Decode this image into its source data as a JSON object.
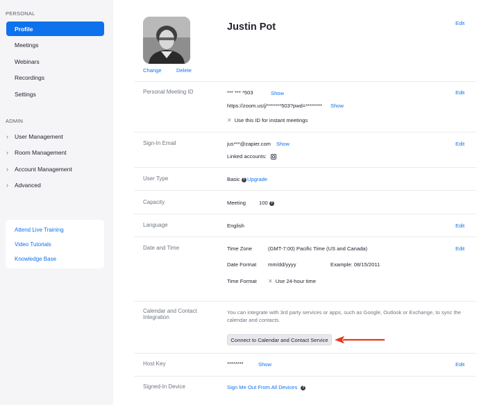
{
  "sidebar": {
    "personal_title": "PERSONAL",
    "personal_items": [
      {
        "label": "Profile",
        "active": true
      },
      {
        "label": "Meetings"
      },
      {
        "label": "Webinars"
      },
      {
        "label": "Recordings"
      },
      {
        "label": "Settings"
      }
    ],
    "admin_title": "ADMIN",
    "admin_items": [
      {
        "label": "User Management"
      },
      {
        "label": "Room Management"
      },
      {
        "label": "Account Management"
      },
      {
        "label": "Advanced"
      }
    ],
    "links": [
      "Attend Live Training",
      "Video Tutorials",
      "Knowledge Base"
    ]
  },
  "profile": {
    "name": "Justin Pot",
    "change": "Change",
    "delete": "Delete",
    "edit": "Edit"
  },
  "pmi": {
    "label": "Personal Meeting ID",
    "id_masked": "*** *** *503",
    "show": "Show",
    "url": "https://zoom.us/j/*******503?pwd=********",
    "url_show": "Show",
    "instant": "Use this ID for instant meetings",
    "edit": "Edit"
  },
  "email": {
    "label": "Sign-In Email",
    "value": "jus***@zapier.com",
    "show": "Show",
    "linked": "Linked accounts:",
    "edit": "Edit"
  },
  "user_type": {
    "label": "User Type",
    "value": "Basic",
    "upgrade": "Upgrade"
  },
  "capacity": {
    "label": "Capacity",
    "meeting": "Meeting",
    "count": "100"
  },
  "language": {
    "label": "Language",
    "value": "English",
    "edit": "Edit"
  },
  "datetime": {
    "label": "Date and Time",
    "tz_label": "Time Zone",
    "tz_value": "(GMT-7:00) Pacific Time (US and Canada)",
    "df_label": "Date Format",
    "df_value": "mm/dd/yyyy",
    "df_example": "Example:  08/15/2011",
    "tf_label": "Time Format",
    "tf_value": "Use 24-hour time",
    "edit": "Edit"
  },
  "calendar": {
    "label_line1": "Calendar and Contact",
    "label_line2": "Integration",
    "desc_line1": "You can integrate with 3rd party services or apps, such as Google, Outlook or Exchange, to sync the",
    "desc_line2": "calendar and contacts.",
    "button": "Connect to Calendar and Contact Service"
  },
  "host_key": {
    "label": "Host Key",
    "value": "********",
    "show": "Show",
    "edit": "Edit"
  },
  "device": {
    "label": "Signed-In Device",
    "signout": "Sign Me Out From All Devices"
  },
  "colors": {
    "accent": "#0e72ed",
    "arrow": "#e5391f",
    "sidebar_bg": "#f5f5f7"
  }
}
